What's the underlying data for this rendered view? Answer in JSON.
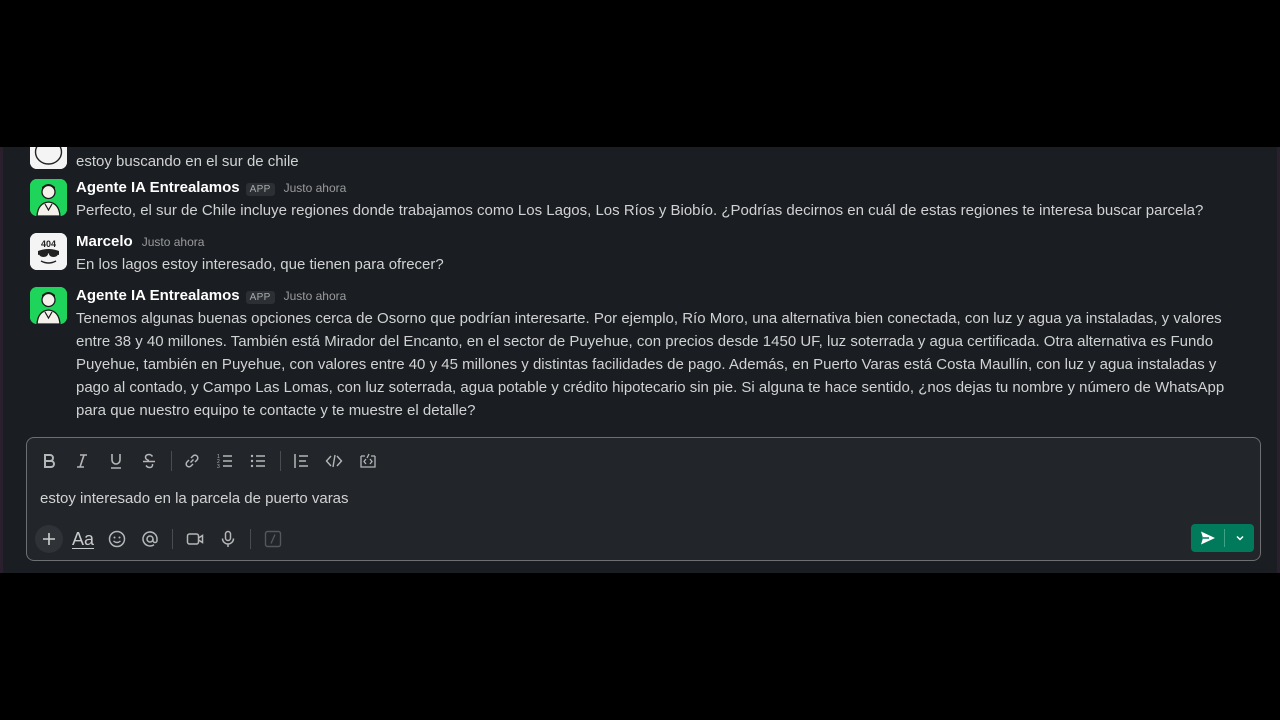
{
  "messages": [
    {
      "author": "",
      "time": "",
      "text": "estoy buscando en el sur de chile"
    },
    {
      "author": "Agente IA Entrealamos",
      "badge": "APP",
      "time": "Justo ahora",
      "text": "Perfecto, el sur de Chile incluye regiones donde trabajamos como Los Lagos, Los Ríos y Biobío. ¿Podrías decirnos en cuál de estas regiones te interesa buscar parcela?"
    },
    {
      "author": "Marcelo",
      "time": "Justo ahora",
      "text": "En los lagos estoy interesado, que tienen para ofrecer?"
    },
    {
      "author": "Agente IA Entrealamos",
      "badge": "APP",
      "time": "Justo ahora",
      "lines": [
        "Tenemos algunas buenas opciones cerca de Osorno que podrían interesarte. Por ejemplo, Río Moro, una alternativa bien conectada, con luz y agua ya instaladas, y valores",
        "entre 38 y 40 millones. También está Mirador del Encanto, en el sector de Puyehue, con precios desde 1450 UF, luz soterrada y agua certificada. Otra alternativa es Fundo",
        "Puyehue, también en Puyehue, con valores entre 40 y 45 millones y distintas facilidades de pago. Además, en Puerto Varas está Costa Maullín, con luz y agua instaladas y",
        "pago al contado, y Campo Las Lomas, con luz soterrada, agua potable y crédito hipotecario sin pie. Si alguna te hace sentido, ¿nos dejas tu nombre y número de WhatsApp",
        "para que nuestro equipo te contacte y te muestre el detalle?"
      ]
    }
  ],
  "avatars": {
    "user_text": "404"
  },
  "composer": {
    "value": "estoy interesado en la parcela de puerto varas",
    "aa_label": "Aa",
    "toolbar_icons": [
      "bold-icon",
      "italic-icon",
      "underline-icon",
      "strikethrough-icon",
      "link-icon",
      "ordered-list-icon",
      "bulleted-list-icon",
      "blockquote-icon",
      "code-icon",
      "code-block-icon"
    ],
    "bottom_icons": [
      "plus-icon",
      "formatting-icon",
      "emoji-icon",
      "mention-icon",
      "video-icon",
      "microphone-icon",
      "shortcuts-icon",
      "send-icon",
      "chevron-down-icon"
    ]
  },
  "colors": {
    "background": "#1a1d21",
    "send_button": "#007a5a",
    "bot_avatar": "#1fd45b"
  }
}
